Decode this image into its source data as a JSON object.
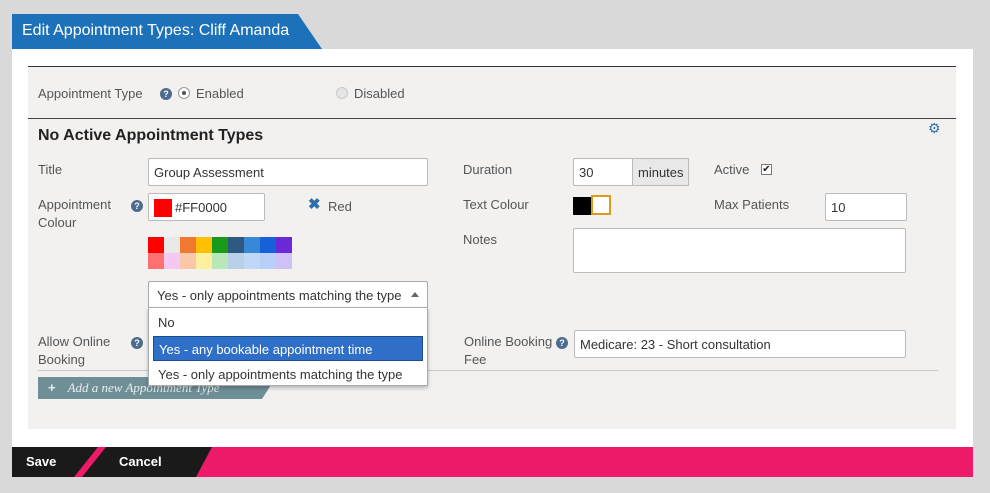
{
  "window": {
    "title": "Edit Appointment Types: Cliff Amanda"
  },
  "appointment_type": {
    "label": "Appointment Type",
    "options": [
      "Enabled",
      "Disabled"
    ],
    "selected": "Enabled"
  },
  "section_title": "No Active Appointment Types",
  "form": {
    "title_label": "Title",
    "title_value": "Group Assessment",
    "colour_label_1": "Appointment",
    "colour_label_2": "Colour",
    "colour_hex": "#FF0000",
    "colour_name": "Red",
    "clear_icon": "x-icon",
    "palette_row1": [
      "#ff0000",
      "#e8e8e8",
      "#f07830",
      "#ffc000",
      "#1a9a1a",
      "#2e5a82",
      "#3888d8",
      "#1660d8",
      "#6a28d8"
    ],
    "palette_row2": [
      "#ff7070",
      "#f4c8f0",
      "#f8c8a8",
      "#fff0a0",
      "#b8e8b8",
      "#b8d0e8",
      "#c0d8f8",
      "#b8d0f8",
      "#d0c0f8"
    ],
    "online_label_1": "Allow Online",
    "online_label_2": "Booking",
    "online_selected": "Yes - only appointments matching the type",
    "online_options": [
      "No",
      "Yes - any bookable appointment time",
      "Yes - only appointments matching the type"
    ],
    "online_highlighted": "Yes - any bookable appointment time",
    "duration_label": "Duration",
    "duration_value": "30",
    "duration_unit": "minutes",
    "active_label": "Active",
    "active_checked": true,
    "text_colour_label": "Text Colour",
    "max_patients_label": "Max Patients",
    "max_patients_value": "10",
    "notes_label": "Notes",
    "notes_value": "",
    "fee_label_1": "Online Booking",
    "fee_label_2": "Fee",
    "fee_value": "Medicare: 23 - Short consultation"
  },
  "add_button_label": "Add a new Appointment Type",
  "footer": {
    "save": "Save",
    "cancel": "Cancel"
  },
  "colors": {
    "accent": "#1d71b8",
    "footer": "#ec1a68",
    "highlight": "#2f6fc7"
  }
}
